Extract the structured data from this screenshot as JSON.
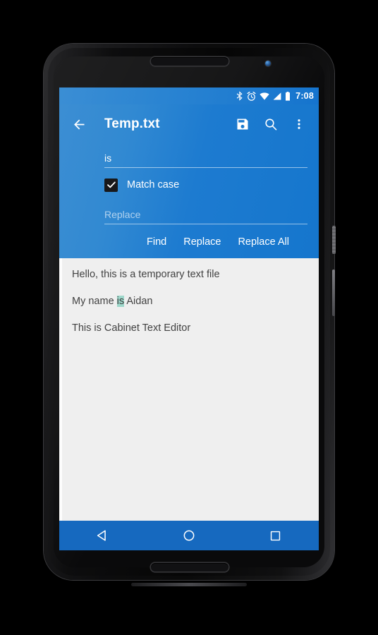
{
  "device": {
    "name": "android-phone-mockup",
    "earpiece": "earpiece-speaker",
    "front_camera": "front-camera"
  },
  "statusbar": {
    "icons": [
      "bluetooth-icon",
      "alarm-icon",
      "wifi-icon",
      "cellular-signal-icon",
      "battery-icon"
    ],
    "time": "7:08"
  },
  "toolbar": {
    "back_icon": "back-arrow-icon",
    "title": "Temp.txt",
    "save_icon": "save-icon",
    "search_icon": "search-icon",
    "overflow_icon": "more-vertical-icon"
  },
  "find_panel": {
    "search_value": "is",
    "search_placeholder": "Find",
    "match_case_label": "Match case",
    "match_case_checked": true,
    "replace_value": "",
    "replace_placeholder": "Replace",
    "buttons": {
      "find": "Find",
      "replace": "Replace",
      "replace_all": "Replace All"
    }
  },
  "document": {
    "lines": [
      {
        "text": "Hello, this is a temporary text file"
      },
      {
        "before": "My name ",
        "highlight": "is",
        "after": " Aidan"
      },
      {
        "text": "This is Cabinet Text Editor"
      }
    ]
  },
  "navbar": {
    "back": "nav-back-icon",
    "home": "nav-home-icon",
    "recents": "nav-recents-icon"
  },
  "colors": {
    "accent_blue": "#1d7bd0",
    "navbar_blue": "#1669bf",
    "highlight_teal": "#9ed8cb",
    "doc_bg": "#efefef",
    "text_gray": "#424242"
  }
}
